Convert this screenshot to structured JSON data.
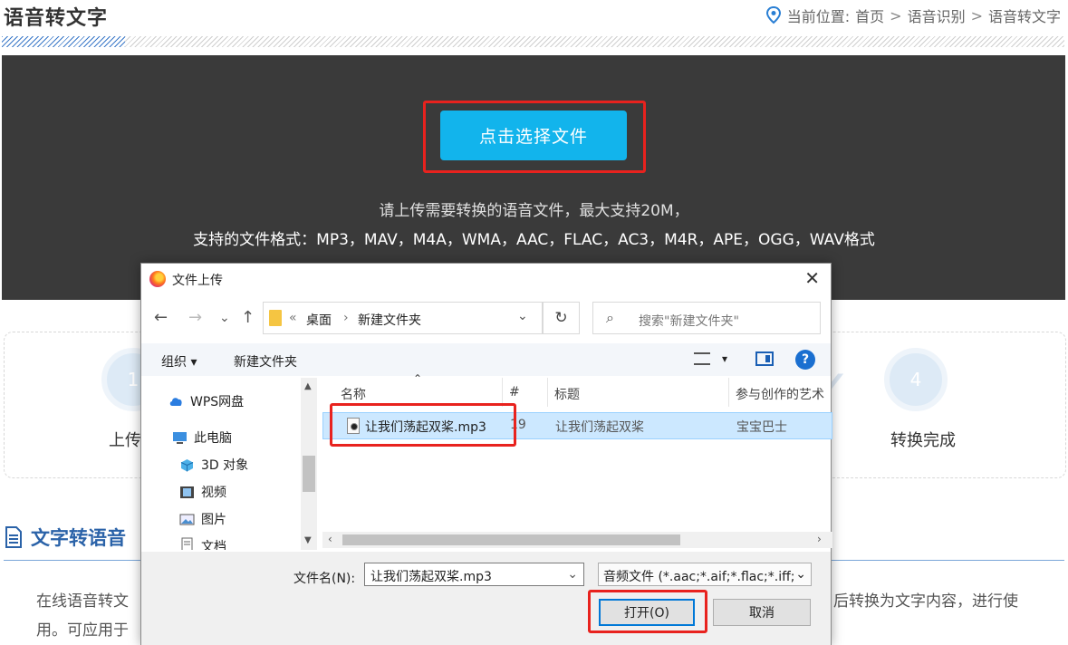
{
  "page": {
    "title": "语音转文字",
    "breadcrumb": {
      "prefix": "当前位置: ",
      "items": [
        "首页",
        "语音识别",
        "语音转文字"
      ],
      "separator": ">"
    }
  },
  "banner": {
    "choose_button": "点击选择文件",
    "line1": "请上传需要转换的语音文件，最大支持20M，",
    "line2": "支持的文件格式：MP3，MAV，M4A，WMA，AAC，FLAC，AC3，M4R，APE，OGG，WAV格式"
  },
  "steps": [
    {
      "number": "1",
      "label": "上传"
    },
    {
      "number": "4",
      "label": "转换完成"
    }
  ],
  "section": {
    "title": "文字转语音",
    "para_line1_left": "在线语音转文",
    "para_line1_right": "后转换为文字内容，进行使",
    "para_line2": "用。可应用于"
  },
  "dialog": {
    "title": "文件上传",
    "close": "✕",
    "nav": {
      "back": "←",
      "forward": "→",
      "recent": "⌄",
      "up": "↑"
    },
    "address": {
      "chevrons": "«",
      "crumb1": "桌面",
      "sep": "›",
      "crumb2": "新建文件夹",
      "dropdown": "⌄"
    },
    "refresh": "↻",
    "search_placeholder": "搜索\"新建文件夹\"",
    "toolbar": {
      "organize": "组织 ▾",
      "new_folder": "新建文件夹",
      "view_dropdown": "▾",
      "help": "?"
    },
    "nav_items": [
      {
        "label": "WPS网盘",
        "icon": "cloud-icon"
      },
      {
        "label": "此电脑",
        "icon": "computer-icon"
      },
      {
        "label": "3D 对象",
        "icon": "cube-icon"
      },
      {
        "label": "视频",
        "icon": "video-icon"
      },
      {
        "label": "图片",
        "icon": "picture-icon"
      },
      {
        "label": "文档",
        "icon": "document-icon"
      }
    ],
    "columns": [
      "名称",
      "#",
      "标题",
      "参与创作的艺术"
    ],
    "files": [
      {
        "name": "让我们荡起双桨.mp3",
        "number": "19",
        "title": "让我们荡起双桨",
        "artist": "宝宝巴士"
      }
    ],
    "filename_label": "文件名(N):",
    "filename_value": "让我们荡起双桨.mp3",
    "filetype_value": "音频文件 (*.aac;*.aif;*.flac;*.iff;",
    "open_button": "打开(O)",
    "cancel_button": "取消"
  },
  "colors": {
    "accent": "#12b4ec",
    "highlight": "#e8221e",
    "section_blue": "#2a62a8",
    "banner_bg": "#3a3a3a"
  }
}
